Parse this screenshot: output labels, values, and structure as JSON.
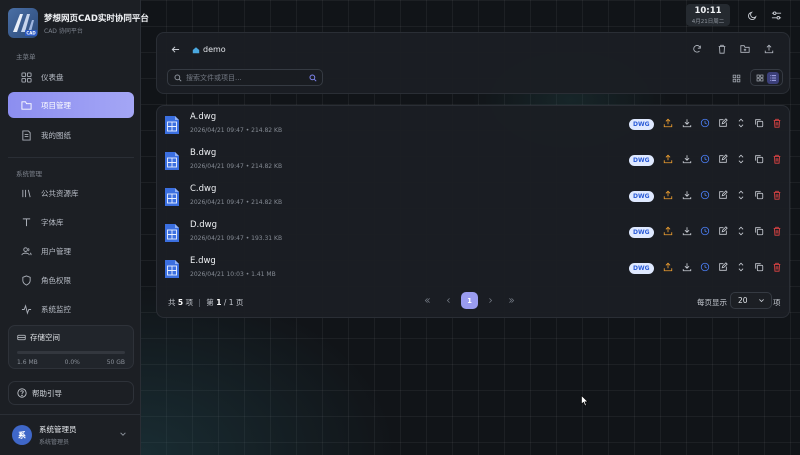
{
  "brand": {
    "title": "梦想网页CAD实时协同平台",
    "subtitle": "CAD 协同平台",
    "logo_badge": "CAD"
  },
  "sidebar": {
    "main_section": "主菜单",
    "main_items": [
      {
        "label": "仪表盘",
        "icon": "dashboard-icon",
        "active": false
      },
      {
        "label": "项目管理",
        "icon": "folder-icon",
        "active": true
      },
      {
        "label": "我的图纸",
        "icon": "document-icon",
        "active": false
      }
    ],
    "system_section": "系统管理",
    "system_items": [
      {
        "label": "公共资源库",
        "icon": "library-icon"
      },
      {
        "label": "字体库",
        "icon": "font-icon"
      },
      {
        "label": "用户管理",
        "icon": "users-icon"
      },
      {
        "label": "角色权限",
        "icon": "shield-icon"
      },
      {
        "label": "系统监控",
        "icon": "activity-icon"
      }
    ],
    "storage": {
      "title": "存储空间",
      "used": "1.6 MB",
      "percent": "0.0%",
      "percent_value": 0.0,
      "total": "50 GB"
    },
    "help": "帮助引导",
    "user": {
      "avatar": "系",
      "name": "系统管理员",
      "role": "系统管理员"
    }
  },
  "topbar": {
    "time": "10:11",
    "date": "4月21日周二",
    "icons": [
      "moon-icon",
      "settings-sliders-icon"
    ]
  },
  "toolbar": {
    "folder": "demo",
    "search_placeholder": "搜索文件或项目...",
    "actions": [
      "refresh-icon",
      "trash-icon",
      "new-folder-icon",
      "upload-icon"
    ],
    "views": [
      "grid-large-icon",
      "grid-icon",
      "list-icon"
    ]
  },
  "files": [
    {
      "name": "A.dwg",
      "meta": "2026/04/21 09:47 • 214.82 KB",
      "type": "DWG"
    },
    {
      "name": "B.dwg",
      "meta": "2026/04/21 09:47 • 214.82 KB",
      "type": "DWG"
    },
    {
      "name": "C.dwg",
      "meta": "2026/04/21 09:47 • 214.82 KB",
      "type": "DWG"
    },
    {
      "name": "D.dwg",
      "meta": "2026/04/21 09:47 • 193.31 KB",
      "type": "DWG"
    },
    {
      "name": "E.dwg",
      "meta": "2026/04/21 10:03 • 1.41 MB",
      "type": "DWG"
    }
  ],
  "row_actions": [
    {
      "icon": "share-upload-icon",
      "color": "#f0a030"
    },
    {
      "icon": "download-icon",
      "color": "#c9cdd4"
    },
    {
      "icon": "history-icon",
      "color": "#4a7cf0"
    },
    {
      "icon": "edit-icon",
      "color": "#c9cdd4"
    },
    {
      "icon": "move-icon",
      "color": "#c9cdd4"
    },
    {
      "icon": "copy-icon",
      "color": "#c9cdd4"
    },
    {
      "icon": "delete-icon",
      "color": "#e64545"
    }
  ],
  "pagination": {
    "total_prefix": "共",
    "total_count": "5",
    "total_suffix": "项",
    "separator": "|",
    "page_prefix": "第",
    "page_current": "1",
    "page_slash": "/",
    "page_total": "1",
    "page_suffix": "页",
    "pages": [
      "1"
    ],
    "per_page_label": "每页显示",
    "per_page_value": "20",
    "per_page_unit": "项"
  }
}
